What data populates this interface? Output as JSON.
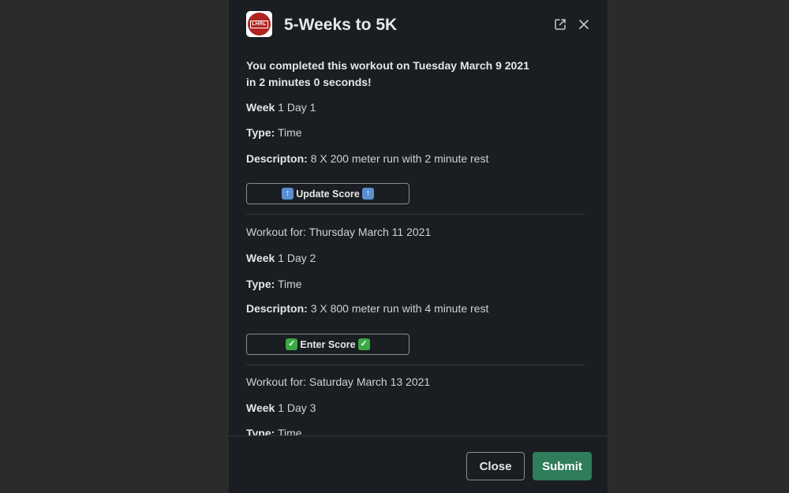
{
  "modal": {
    "title": "5-Weeks to 5K",
    "logo_text": "LHRL",
    "open_icon": "external-link-icon",
    "close_icon": "close-icon"
  },
  "completed": {
    "line1": "You completed this workout on Tuesday March 9 2021",
    "line2": "in 2 minutes 0 seconds!"
  },
  "labels": {
    "week": "Week",
    "type": "Type:",
    "description": "Descripton:",
    "workout_for": "Workout for:"
  },
  "workouts": [
    {
      "week_day": "1 Day 1",
      "type": "Time",
      "description": "8 X 200 meter run with 2 minute rest",
      "button_label": "Update Score",
      "button_emoji": "up-arrow-icon"
    },
    {
      "date": "Thursday March 11 2021",
      "week_day": "1 Day 2",
      "type": "Time",
      "description": "3 X 800 meter run with 4 minute rest",
      "button_label": "Enter Score",
      "button_emoji": "check-mark-icon"
    },
    {
      "date": "Saturday March 13 2021",
      "week_day": "1 Day 3",
      "type": "Time"
    }
  ],
  "footer": {
    "close_label": "Close",
    "submit_label": "Submit"
  },
  "colors": {
    "backdrop": "#2b2b2b",
    "modal_bg": "#1a1d21",
    "submit": "#2f7d5b",
    "logo_red": "#b0231f"
  }
}
